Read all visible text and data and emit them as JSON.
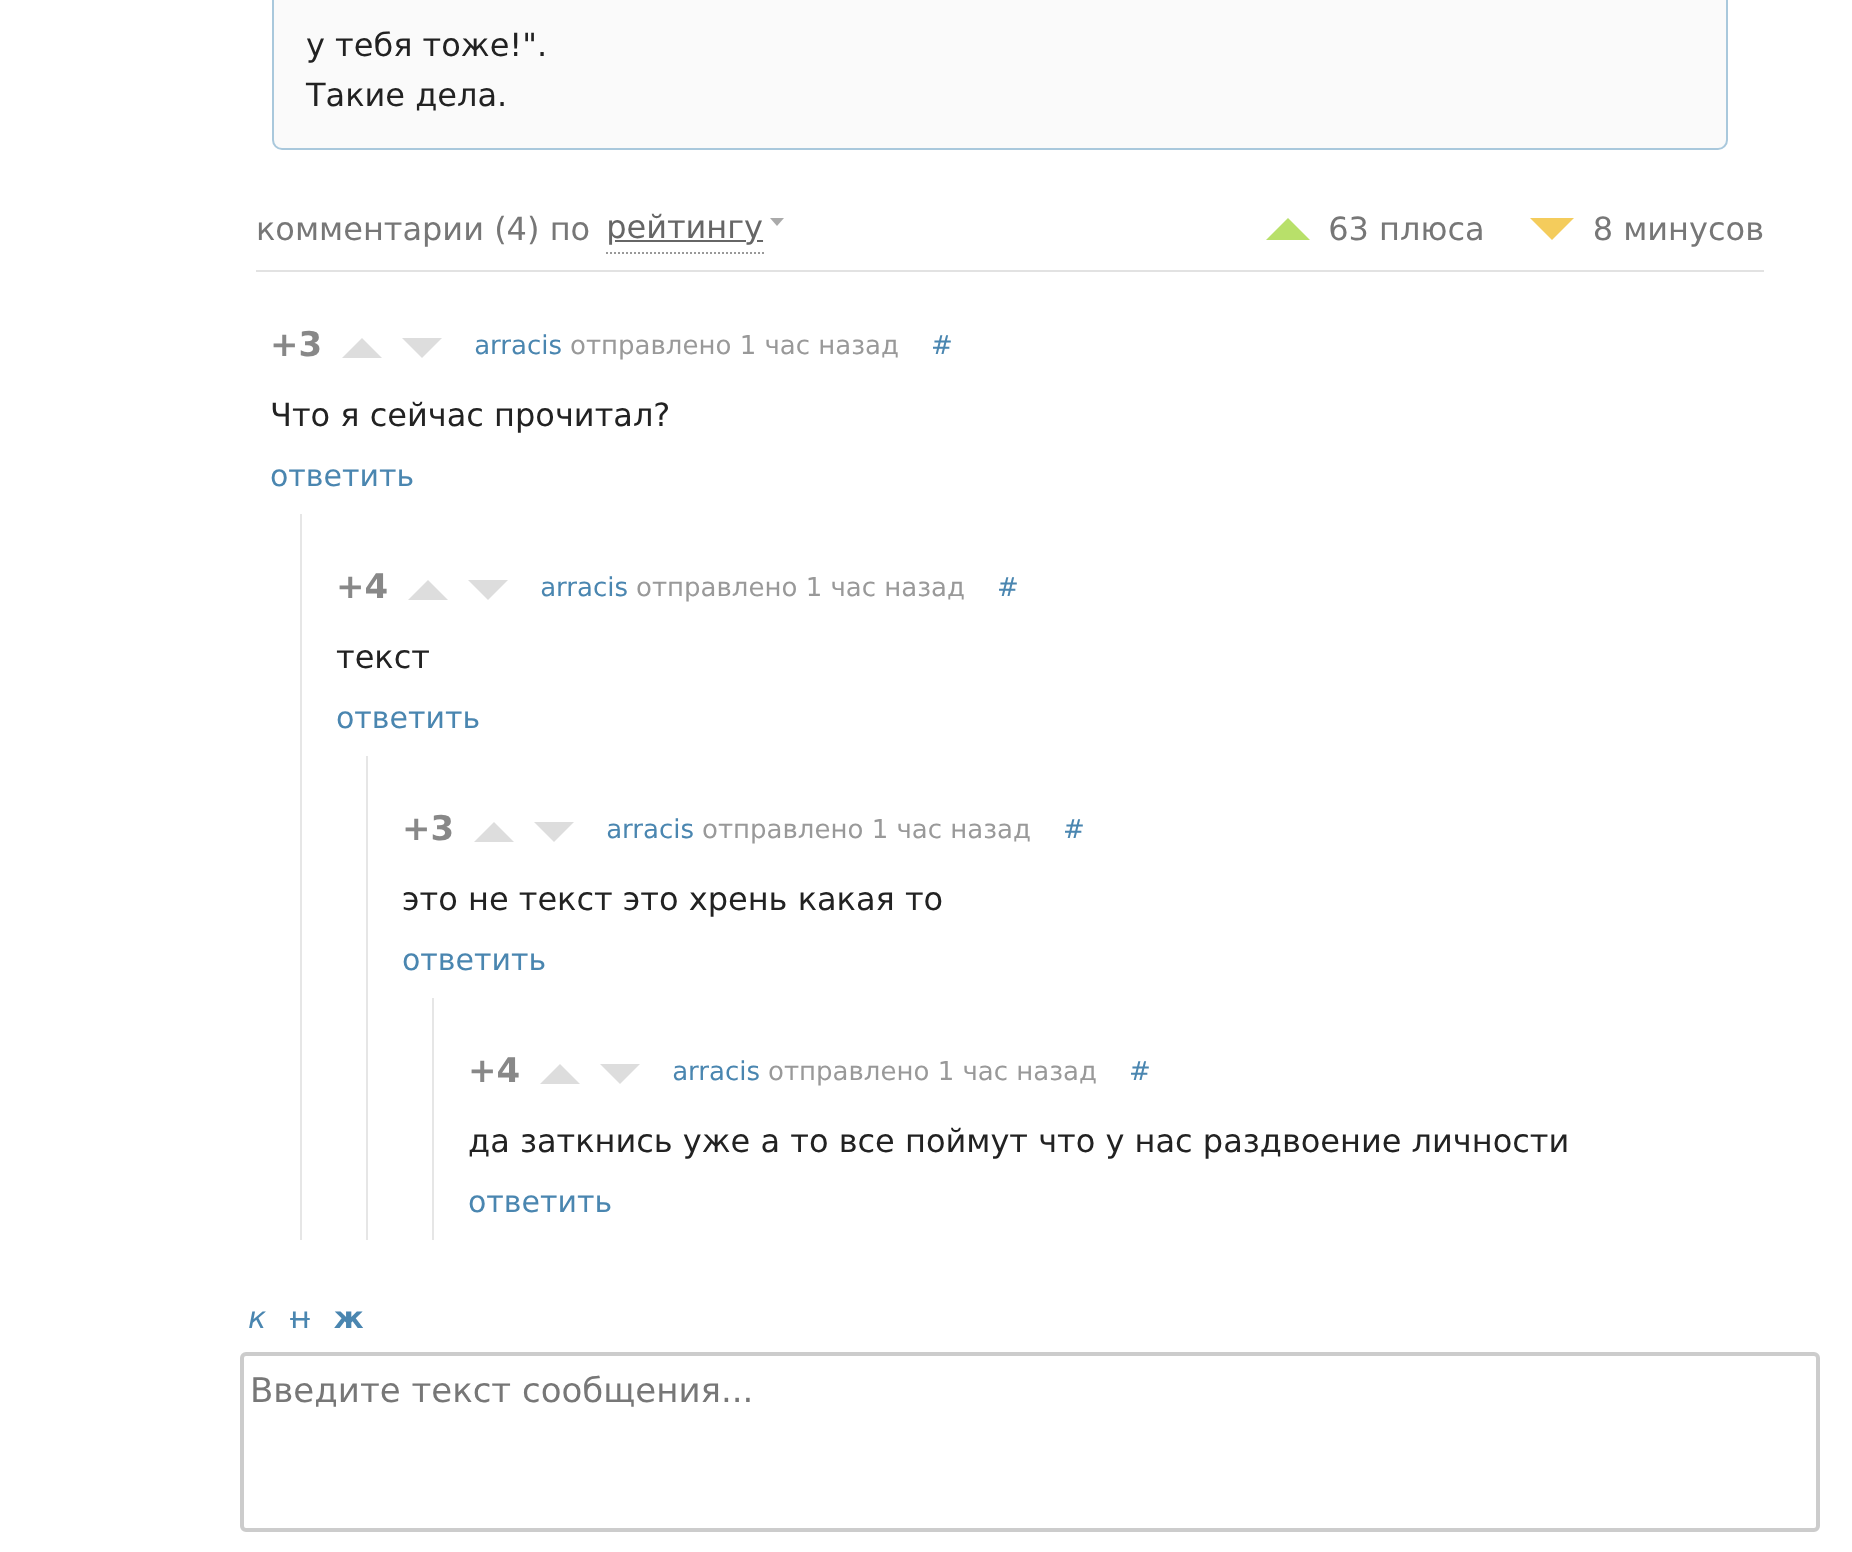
{
  "post": {
    "lines": [
      "у тебя тоже!\".",
      "Такие дела."
    ]
  },
  "comments_header": {
    "label": "комментарии (4) по",
    "sort": "рейтингу",
    "pluses": "63 плюса",
    "minuses": "8 минусов"
  },
  "comments": [
    {
      "rating": "+3",
      "author": "arracis",
      "meta": "отправлено 1 час назад",
      "anchor": "#",
      "text": "Что я сейчас прочитал?",
      "reply": "ответить",
      "children": [
        {
          "rating": "+4",
          "author": "arracis",
          "meta": "отправлено 1 час назад",
          "anchor": "#",
          "text": "текст",
          "reply": "ответить",
          "children": [
            {
              "rating": "+3",
              "author": "arracis",
              "meta": "отправлено 1 час назад",
              "anchor": "#",
              "text": "это не текст это хрень какая то",
              "reply": "ответить",
              "children": [
                {
                  "rating": "+4",
                  "author": "arracis",
                  "meta": "отправлено 1 час назад",
                  "anchor": "#",
                  "text": "да заткнись уже а то все поймут что у нас раздвоение личности",
                  "reply": "ответить"
                }
              ]
            }
          ]
        }
      ]
    }
  ],
  "editor": {
    "format_buttons": [
      {
        "label": "к",
        "kind": "italic"
      },
      {
        "label": "н",
        "kind": "strike"
      },
      {
        "label": "ж",
        "kind": "bold"
      }
    ],
    "placeholder": "Введите текст сообщения..."
  }
}
